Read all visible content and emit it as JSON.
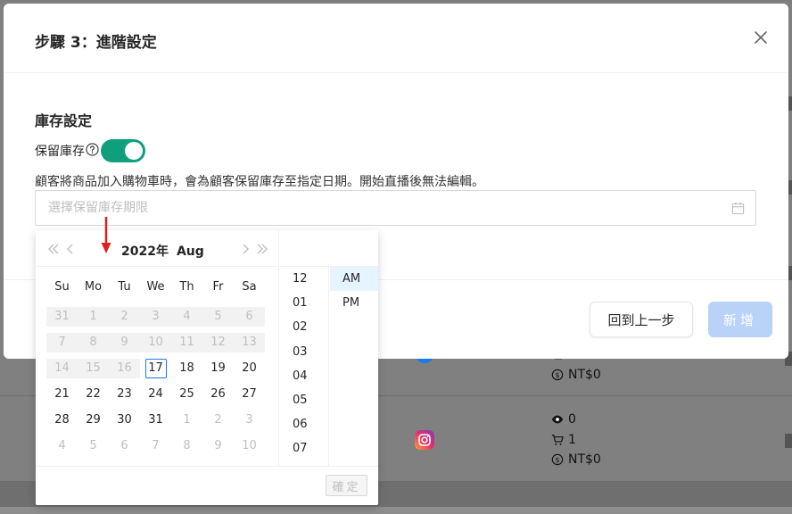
{
  "background": {
    "rows": [
      {
        "views": "0",
        "cart": "1",
        "amount": "NT$0"
      }
    ],
    "partial_amount": "NT$0"
  },
  "modal": {
    "title": "步驟 3：進階設定",
    "section_title": "庫存設定",
    "reserve_label": "保留庫存",
    "toggle_on": true,
    "description": "顧客將商品加入購物車時，會為顧客保留庫存至指定日期。開始直播後無法編輯。",
    "date_placeholder": "選擇保留庫存期限",
    "back_button": "回到上一步",
    "add_button": "新增"
  },
  "picker": {
    "year": "2022年",
    "month": "Aug",
    "weekdays": [
      "Su",
      "Mo",
      "Tu",
      "We",
      "Th",
      "Fr",
      "Sa"
    ],
    "weeks": [
      [
        {
          "d": "31",
          "s": "disabled"
        },
        {
          "d": "1",
          "s": "disabled"
        },
        {
          "d": "2",
          "s": "disabled"
        },
        {
          "d": "3",
          "s": "disabled"
        },
        {
          "d": "4",
          "s": "disabled"
        },
        {
          "d": "5",
          "s": "disabled"
        },
        {
          "d": "6",
          "s": "disabled"
        }
      ],
      [
        {
          "d": "7",
          "s": "disabled"
        },
        {
          "d": "8",
          "s": "disabled"
        },
        {
          "d": "9",
          "s": "disabled"
        },
        {
          "d": "10",
          "s": "disabled"
        },
        {
          "d": "11",
          "s": "disabled"
        },
        {
          "d": "12",
          "s": "disabled"
        },
        {
          "d": "13",
          "s": "disabled"
        }
      ],
      [
        {
          "d": "14",
          "s": "disabled"
        },
        {
          "d": "15",
          "s": "disabled"
        },
        {
          "d": "16",
          "s": "disabled"
        },
        {
          "d": "17",
          "s": "today"
        },
        {
          "d": "18",
          "s": "normal"
        },
        {
          "d": "19",
          "s": "normal"
        },
        {
          "d": "20",
          "s": "normal"
        }
      ],
      [
        {
          "d": "21",
          "s": "normal"
        },
        {
          "d": "22",
          "s": "normal"
        },
        {
          "d": "23",
          "s": "normal"
        },
        {
          "d": "24",
          "s": "normal"
        },
        {
          "d": "25",
          "s": "normal"
        },
        {
          "d": "26",
          "s": "normal"
        },
        {
          "d": "27",
          "s": "normal"
        }
      ],
      [
        {
          "d": "28",
          "s": "normal"
        },
        {
          "d": "29",
          "s": "normal"
        },
        {
          "d": "30",
          "s": "normal"
        },
        {
          "d": "31",
          "s": "normal"
        },
        {
          "d": "1",
          "s": "muted"
        },
        {
          "d": "2",
          "s": "muted"
        },
        {
          "d": "3",
          "s": "muted"
        }
      ],
      [
        {
          "d": "4",
          "s": "muted"
        },
        {
          "d": "5",
          "s": "muted"
        },
        {
          "d": "6",
          "s": "muted"
        },
        {
          "d": "7",
          "s": "muted"
        },
        {
          "d": "8",
          "s": "muted"
        },
        {
          "d": "9",
          "s": "muted"
        },
        {
          "d": "10",
          "s": "muted"
        }
      ]
    ],
    "hours": [
      "12",
      "01",
      "02",
      "03",
      "04",
      "05",
      "06",
      "07"
    ],
    "selected_hour": "",
    "ampm": [
      "AM",
      "PM"
    ],
    "selected_ampm": "AM",
    "ok_button": "確定"
  },
  "colors": {
    "toggle": "#0f9f7d",
    "primary_disabled": "#b8d3f7",
    "today_border": "#1677ff",
    "arrow": "#e02020"
  },
  "icons": {
    "close": "close-icon",
    "help": "question-circle-icon",
    "calendar": "calendar-icon",
    "super_prev": "double-chevron-left-icon",
    "prev": "chevron-left-icon",
    "next": "chevron-right-icon",
    "super_next": "double-chevron-right-icon"
  }
}
